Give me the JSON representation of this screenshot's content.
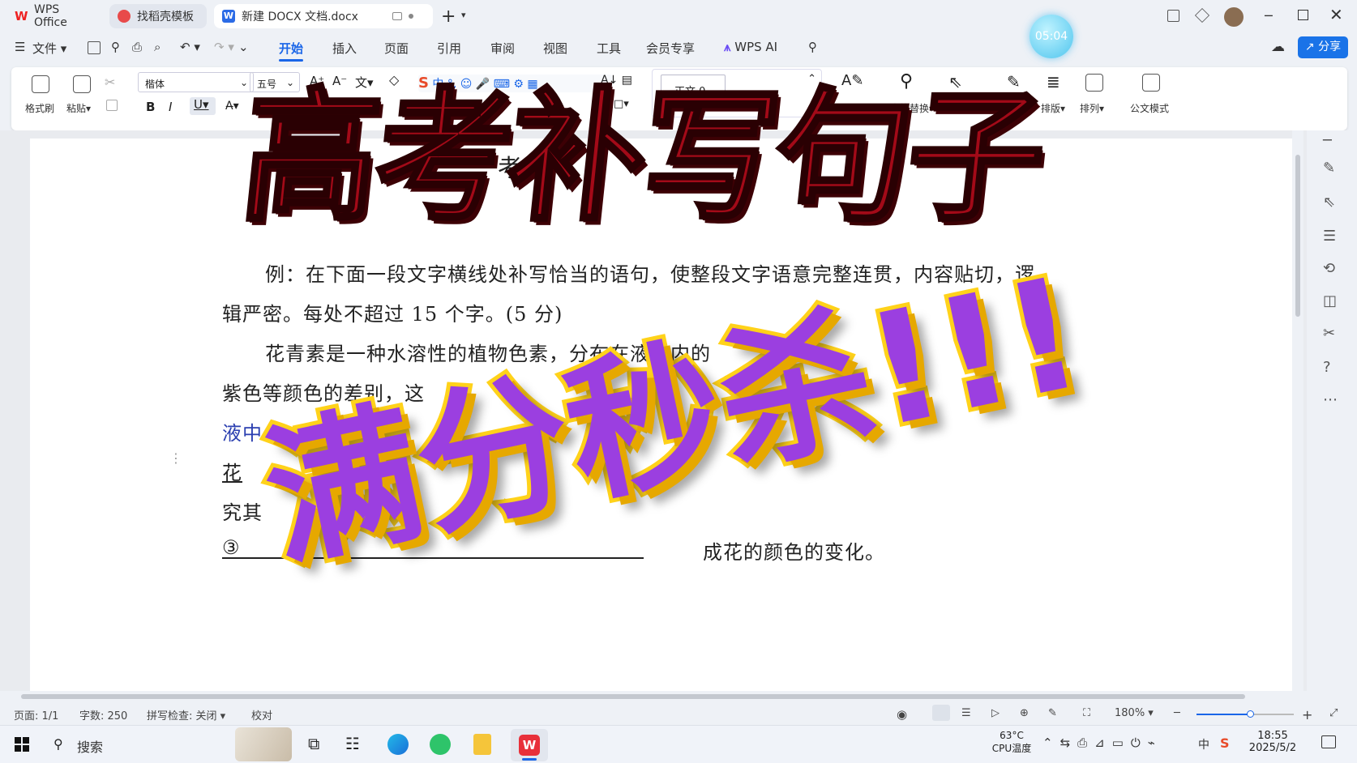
{
  "tabs": [
    {
      "label": "WPS Office"
    },
    {
      "label": "找稻壳模板"
    },
    {
      "label": "新建 DOCX 文档.docx"
    }
  ],
  "timer": "05:04",
  "menu": {
    "file": "文件",
    "items": [
      "开始",
      "插入",
      "页面",
      "引用",
      "审阅",
      "视图",
      "工具",
      "会员专享"
    ],
    "wps_ai": "WPS AI",
    "share": "分享"
  },
  "ribbon": {
    "format_painter": "格式刷",
    "paste": "粘贴",
    "font_name": "楷体",
    "font_size": "五号",
    "style": "正文 0",
    "find_replace": "查找替换",
    "layout": "排版",
    "arrange": "排列",
    "official_mode": "公文模式",
    "ime": "中"
  },
  "document": {
    "heading_fragment": "考",
    "lines": [
      "例：在下面一段文字横线处补写恰当的语句，使整段文字语意完整连贯，内容贴切，逻",
      "辑严密。每处不超过 15 个字。(5 分)",
      "花青素是一种水溶性的植物色素，分布在液泡内的",
      "紫色等颜色的差别，这",
      "液中",
      "花",
      "究其",
      "③",
      "成花的颜色的变化。"
    ]
  },
  "overlay": {
    "title": "高考补写句子",
    "subtitle": "满分秒杀!!!"
  },
  "status": {
    "page": "页面: 1/1",
    "words": "字数: 250",
    "spell": "拼写检查: 关闭",
    "proof": "校对",
    "zoom": "180%"
  },
  "taskbar": {
    "search": "搜索",
    "temp": "63°C",
    "temp_label": "CPU温度",
    "ime": "中",
    "time": "18:55",
    "date": "2025/5/2"
  },
  "colors": {
    "accent": "#1a73e8",
    "title_red": "#a30a18",
    "sub_purple": "#9b3fe0",
    "sub_yellow": "#ffd21a"
  }
}
